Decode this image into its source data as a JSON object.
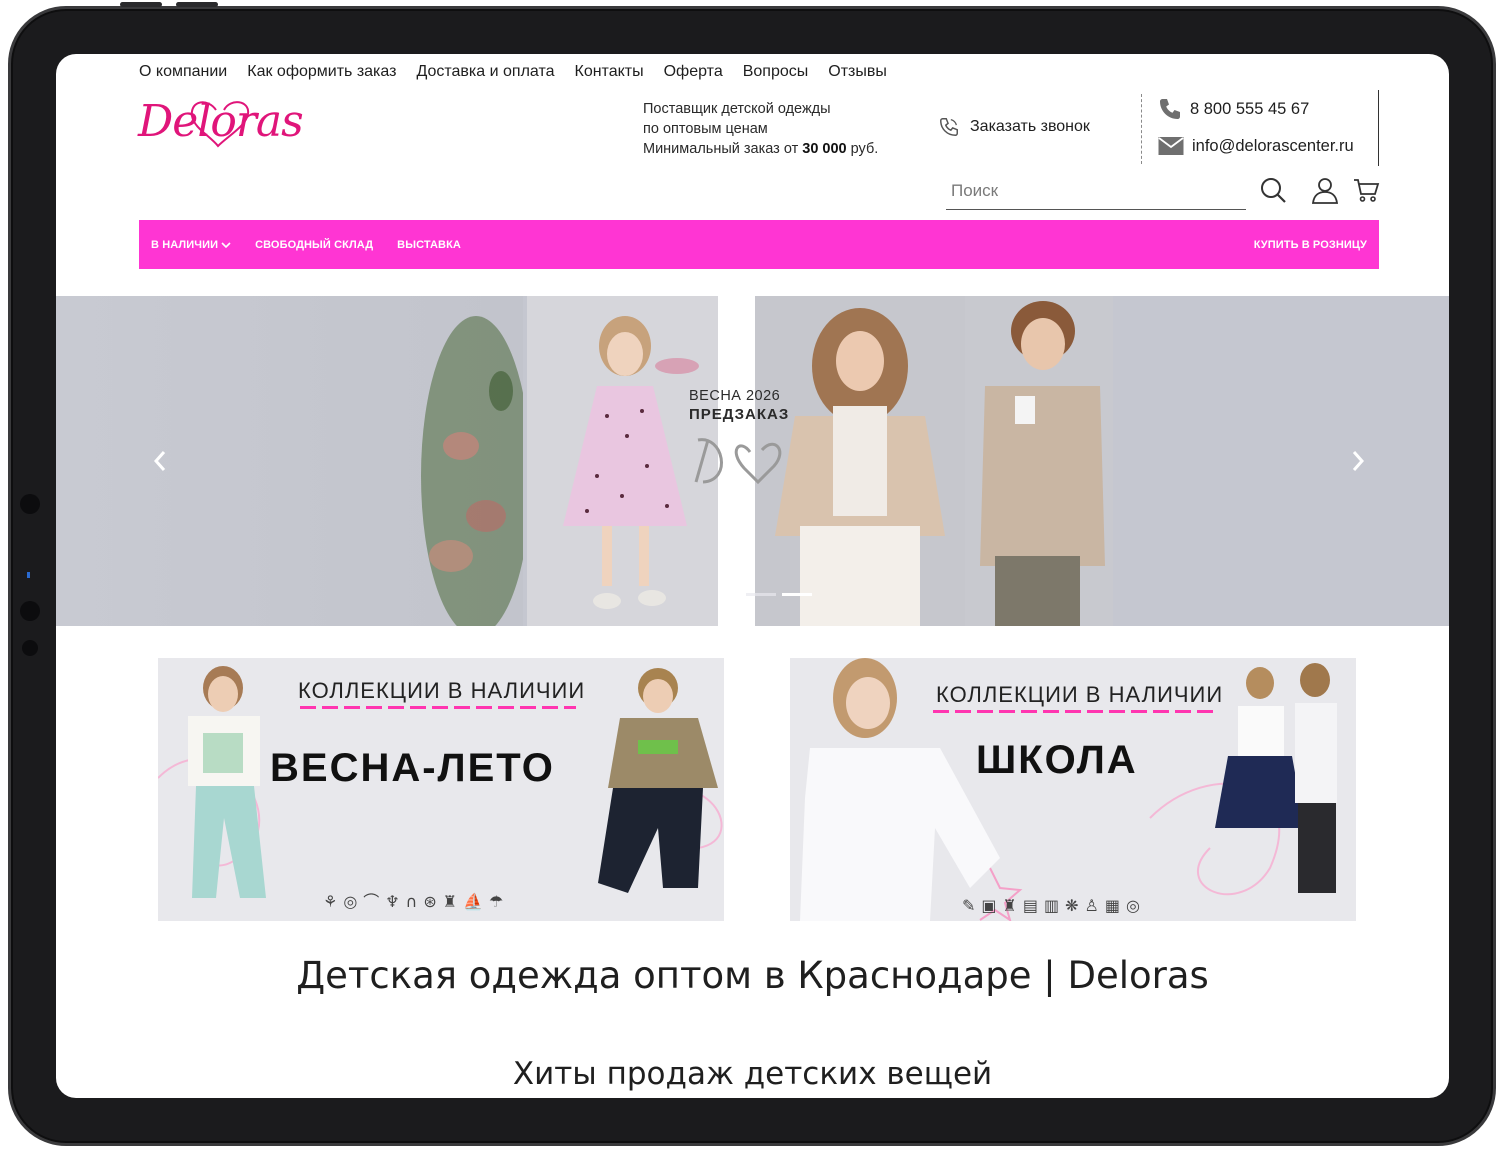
{
  "topnav": [
    "О компании",
    "Как оформить заказ",
    "Доставка и оплата",
    "Контакты",
    "Оферта",
    "Вопросы",
    "Отзывы"
  ],
  "logo_text": "Deloras",
  "supplier": {
    "line1": "Поставщик детской одежды",
    "line2": "по оптовым ценам",
    "line3_prefix": "Минимальный заказ от ",
    "line3_amount": "30 000",
    "line3_suffix": " руб."
  },
  "callback_label": "Заказать звонок",
  "phone": "8 800 555 45 67",
  "email": "info@delorascenter.ru",
  "search_placeholder": "Поиск",
  "categories": {
    "in_stock": "В НАЛИЧИИ",
    "free_stock": "СВОБОДНЫЙ СКЛАД",
    "exhibition": "ВЫСТАВКА",
    "retail": "КУПИТЬ В РОЗНИЦУ"
  },
  "hero": {
    "line1": "ВЕСНА 2026",
    "line2": "ПРЕДЗАКАЗ",
    "slides": 2,
    "active_slide": 2
  },
  "banners": [
    {
      "subtitle": "КОЛЛЕКЦИИ В НАЛИЧИИ",
      "title": "ВЕСНА-ЛЕТО"
    },
    {
      "subtitle": "КОЛЛЕКЦИИ В НАЛИЧИИ",
      "title": "ШКОЛА"
    }
  ],
  "heading": "Детская одежда оптом в Краснодаре | Deloras",
  "subheading": "Хиты продаж детских вещей",
  "colors": {
    "brand_pink": "#e0157a",
    "category_bar": "#ff35d3",
    "hero_bg": "#c5c7d0"
  }
}
